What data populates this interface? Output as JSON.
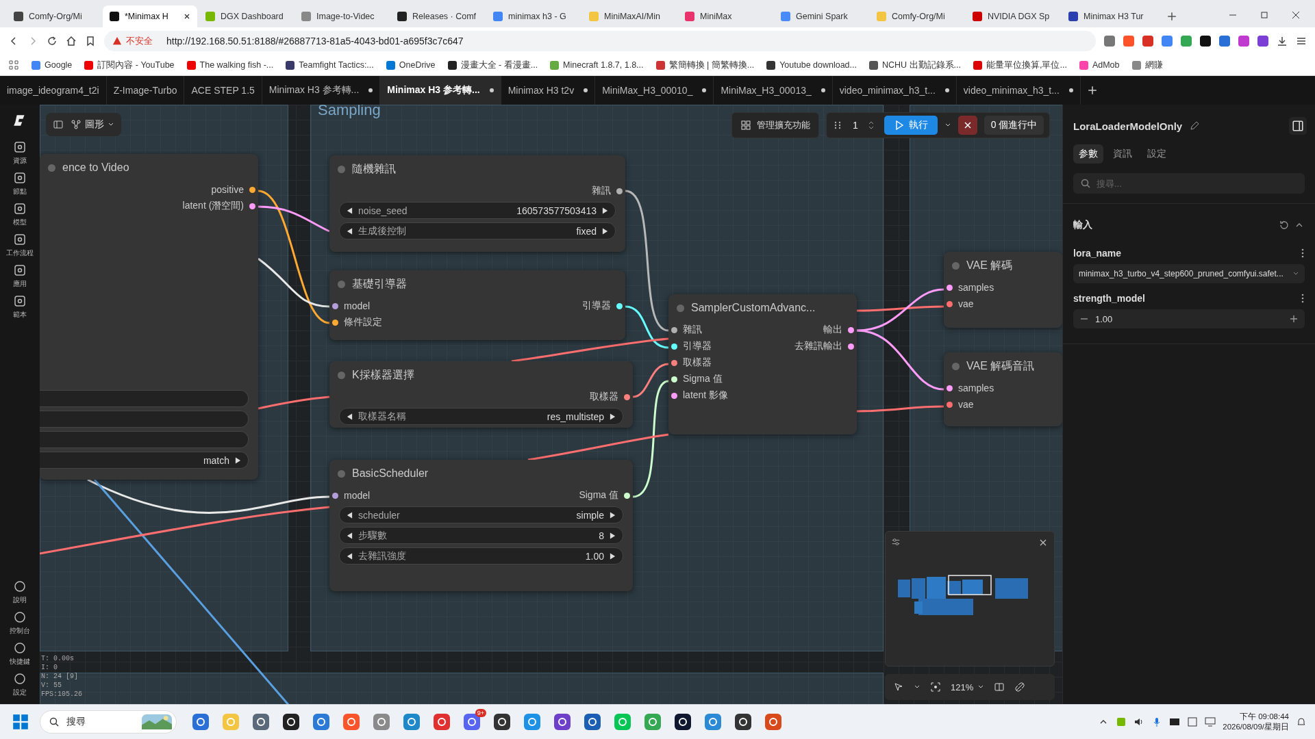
{
  "browser_tabs": [
    {
      "title": "Comfy-Org/Mi",
      "selected": false
    },
    {
      "title": "*Minimax H",
      "selected": true
    },
    {
      "title": "DGX Dashboard",
      "selected": false
    },
    {
      "title": "Image-to-Videc",
      "selected": false
    },
    {
      "title": "Releases · Comf",
      "selected": false
    },
    {
      "title": "minimax h3 - G",
      "selected": false
    },
    {
      "title": "MiniMaxAI/Min",
      "selected": false
    },
    {
      "title": "MiniMax",
      "selected": false
    },
    {
      "title": "Gemini Spark",
      "selected": false
    },
    {
      "title": "Comfy-Org/Mi",
      "selected": false
    },
    {
      "title": "NVIDIA DGX Sp",
      "selected": false
    },
    {
      "title": "Minimax H3 Tur",
      "selected": false
    }
  ],
  "address_bar": {
    "security": "不安全",
    "url": "http://192.168.50.51:8188/#26887713-81a5-4043-bd01-a695f3c7c647"
  },
  "bookmarks": [
    "Google",
    "訂閱內容 - YouTube",
    "The walking fish -...",
    "Teamfight Tactics:...",
    "OneDrive",
    "漫畫大全 - 看漫畫...",
    "Minecraft 1.8.7, 1.8...",
    "繁簡轉換 | 簡繁轉換...",
    "Youtube download...",
    "NCHU 出勤記錄系...",
    "能量單位換算,單位...",
    "AdMob",
    "網賺"
  ],
  "workflow_tabs": [
    {
      "title": "image_ideogram4_t2i",
      "selected": false,
      "unsaved": false
    },
    {
      "title": "Z-Image-Turbo",
      "selected": false,
      "unsaved": false
    },
    {
      "title": "ACE STEP 1.5",
      "selected": false,
      "unsaved": false
    },
    {
      "title": "Minimax H3 参考轉...",
      "selected": false,
      "unsaved": true
    },
    {
      "title": "Minimax H3 参考轉...",
      "selected": true,
      "unsaved": true
    },
    {
      "title": "Minimax H3 t2v",
      "selected": false,
      "unsaved": true
    },
    {
      "title": "MiniMax_H3_00010_",
      "selected": false,
      "unsaved": true
    },
    {
      "title": "MiniMax_H3_00013_",
      "selected": false,
      "unsaved": true
    },
    {
      "title": "video_minimax_h3_t...",
      "selected": false,
      "unsaved": true
    },
    {
      "title": "video_minimax_h3_t...",
      "selected": false,
      "unsaved": true
    }
  ],
  "sidebar": {
    "items": [
      "資源",
      "節點",
      "模型",
      "工作流程",
      "應用",
      "範本"
    ],
    "bottom_items": [
      "說明",
      "控制台",
      "快捷鍵",
      "設定"
    ]
  },
  "canvas_toolbar": {
    "mode": "圖形"
  },
  "groups": [
    {
      "title": "Sampling"
    }
  ],
  "nodes": [
    {
      "title": "ence to Video",
      "outputs": [
        {
          "label": "positive",
          "color": "#ffa931"
        },
        {
          "label": "latent (潛空間)",
          "color": "#ff9cf9"
        }
      ],
      "widgets": [
        {
          "kind": "blank"
        },
        {
          "kind": "blank"
        },
        {
          "kind": "blank"
        },
        {
          "kind": "partial",
          "value": "match"
        }
      ]
    },
    {
      "title": "隨機雜訊",
      "outputs": [
        {
          "label": "雜訊",
          "color": "#b0b0b0"
        }
      ],
      "widgets": [
        {
          "kind": "combo",
          "label": "noise_seed",
          "value": "160573577503413"
        },
        {
          "kind": "combo",
          "label": "生成後控制",
          "value": "fixed"
        }
      ]
    },
    {
      "title": "基礎引導器",
      "inputs": [
        {
          "label": "model",
          "color": "#b39ddb"
        },
        {
          "label": "條件設定",
          "color": "#ffa931"
        }
      ],
      "outputs": [
        {
          "label": "引導器",
          "color": "#66ffff"
        }
      ]
    },
    {
      "title": "K採樣器選擇",
      "outputs": [
        {
          "label": "取樣器",
          "color": "#ff7e7e"
        }
      ],
      "widgets": [
        {
          "kind": "combo",
          "label": "取樣器名稱",
          "value": "res_multistep"
        }
      ]
    },
    {
      "title": "BasicScheduler",
      "inputs": [
        {
          "label": "model",
          "color": "#b39ddb"
        }
      ],
      "outputs": [
        {
          "label": "Sigma 值",
          "color": "#cdffcd"
        }
      ],
      "widgets": [
        {
          "kind": "combo",
          "label": "scheduler",
          "value": "simple"
        },
        {
          "kind": "combo",
          "label": "步驟數",
          "value": "8"
        },
        {
          "kind": "combo",
          "label": "去雜訊強度",
          "value": "1.00"
        }
      ]
    },
    {
      "title": "SamplerCustomAdvanc...",
      "inputs": [
        {
          "label": "雜訊",
          "color": "#b0b0b0"
        },
        {
          "label": "引導器",
          "color": "#66ffff"
        },
        {
          "label": "取樣器",
          "color": "#ff7e7e"
        },
        {
          "label": "Sigma 值",
          "color": "#cdffcd"
        },
        {
          "label": "latent 影像",
          "color": "#ff9cf9"
        }
      ],
      "outputs": [
        {
          "label": "輸出",
          "color": "#ff9cf9"
        },
        {
          "label": "去雜訊輸出",
          "color": "#ff9cf9"
        }
      ]
    },
    {
      "title": "VAE 解碼",
      "inputs": [
        {
          "label": "samples",
          "color": "#ff9cf9"
        },
        {
          "label": "vae",
          "color": "#ff6e6e"
        }
      ]
    },
    {
      "title": "VAE 解碼音訊",
      "inputs": [
        {
          "label": "samples",
          "color": "#ff9cf9"
        },
        {
          "label": "vae",
          "color": "#ff6e6e"
        }
      ]
    }
  ],
  "run_toolbar": {
    "extensions": "管理擴充功能",
    "batch_count": "1",
    "run": "執行",
    "queue": "0 個進行中"
  },
  "stats": [
    "T: 0.00s",
    "I: 0",
    "N: 24 [9]",
    "V: 55",
    "FPS:105.26"
  ],
  "zoom_controls": {
    "zoom": "121%"
  },
  "properties_panel": {
    "title": "LoraLoaderModelOnly",
    "tabs": [
      {
        "label": "参數",
        "selected": true
      },
      {
        "label": "資訊",
        "selected": false
      },
      {
        "label": "設定",
        "selected": false
      }
    ],
    "search_placeholder": "搜尋...",
    "section": "輸入",
    "fields": [
      {
        "kind": "combo",
        "label": "lora_name",
        "value": "minimax_h3_turbo_v4_step600_pruned_comfyui.safet..."
      },
      {
        "kind": "number",
        "label": "strength_model",
        "value": "1.00"
      }
    ]
  },
  "taskbar": {
    "search_placeholder": "搜尋",
    "badge": "9+",
    "time": "下午 09:08:44",
    "date": "2026/08/09/星期日"
  }
}
